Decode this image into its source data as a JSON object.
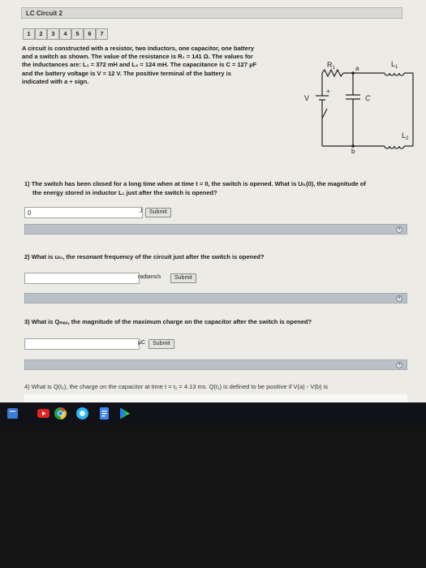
{
  "header": {
    "title": "LC Circuit 2"
  },
  "tabs": [
    "1",
    "2",
    "3",
    "4",
    "5",
    "6",
    "7"
  ],
  "intro_lines": [
    "A circuit is constructed with a resistor, two inductors, one capacitor, one battery",
    "and a switch as shown. The value of the resistance is R₁ = 141 Ω. The values for",
    "the inductances are: L₁ = 372 mH and L₂ = 124 mH. The capacitance is C = 127 μF",
    "and the battery voltage is V = 12 V. The positive terminal of the battery is",
    "indicated with a + sign."
  ],
  "circuit": {
    "R": "R",
    "R_sub": "1",
    "L1": "L",
    "L1_sub": "1",
    "L2": "L",
    "L2_sub": "2",
    "C": "C",
    "V": "V",
    "a": "a",
    "b": "b",
    "plus": "+"
  },
  "q1": {
    "line1": "1) The switch has been closed for a long time when at time t = 0, the switch is opened. What is Uₗ₁(0), the magnitude of",
    "line2": "the energy stored in inductor L₁ just after the switch is opened?",
    "value": "0",
    "unit": "J",
    "submit": "Submit"
  },
  "q2": {
    "text": "2) What is ω₀, the resonant frequency of the circuit just after the switch is opened?",
    "value": "",
    "unit": "radians/s",
    "submit": "Submit"
  },
  "q3": {
    "text": "3) What is Qₘₐₓ, the magnitude of the maximum charge on the capacitor after the switch is opened?",
    "value": "",
    "unit": "μC",
    "submit": "Submit"
  },
  "q4": {
    "text": "4) What is Q(t₁), the charge on the capacitor at time t = t₁ = 4.13 ms. Q(t₁) is defined to be positive if V(a) - V(b) is"
  },
  "expand_symbol": "+",
  "taskbar": {
    "icons": [
      "files-icon",
      "youtube-icon",
      "chrome-icon",
      "app-icon",
      "docs-icon",
      "play-store-icon"
    ]
  }
}
